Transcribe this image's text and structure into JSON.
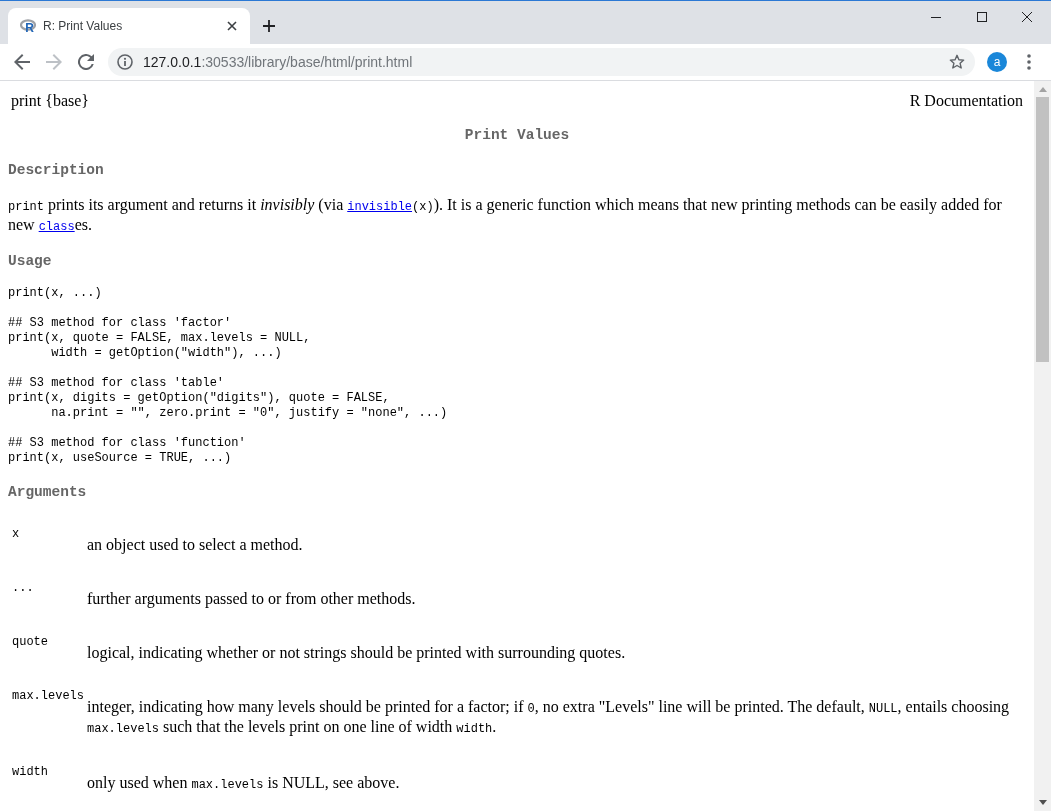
{
  "tabs": [
    {
      "title": "R: Print Values",
      "favicon": "R",
      "selected": true
    }
  ],
  "toolbar": {
    "forward_disabled": true,
    "url": {
      "host": "127.0.0.1",
      "path": ":30533/library/base/html/print.html"
    },
    "profile": "a"
  },
  "page": {
    "header": {
      "left": "print {base}",
      "right": "R Documentation"
    },
    "title": "Print Values",
    "sections": [
      {
        "kind": "paragraph",
        "heading": "Description",
        "segments": [
          {
            "kind": "code",
            "text": "print"
          },
          {
            "kind": "text",
            "text": " prints its argument and returns it *invisibly* (via "
          },
          {
            "kind": "link",
            "text": "invisible"
          },
          {
            "kind": "code",
            "text": "(x)"
          },
          {
            "kind": "text",
            "text": "). It is a generic function which means that new printing methods can be easily added for new "
          },
          {
            "kind": "link",
            "text": "class"
          },
          {
            "kind": "text",
            "text": "es."
          }
        ]
      },
      {
        "kind": "code",
        "heading": "Usage",
        "blocks": [
          "print(x, ...)",
          "## S3 method for class 'factor'\nprint(x, quote = FALSE, max.levels = NULL,\n      width = getOption(\"width\"), ...)",
          "## S3 method for class 'table'\nprint(x, digits = getOption(\"digits\"), quote = FALSE,\n      na.print = \"\", zero.print = \"0\", justify = \"none\", ...)",
          "## S3 method for class 'function'\nprint(x, useSource = TRUE, ...)"
        ]
      },
      {
        "kind": "arguments",
        "heading": "Arguments",
        "items": [
          {
            "name": "x",
            "description": [
              {
                "kind": "text",
                "text": "an object used to select a method."
              }
            ]
          },
          {
            "name": "...",
            "description": [
              {
                "kind": "text",
                "text": "further arguments passed to or from other methods."
              }
            ]
          },
          {
            "name": "quote",
            "description": [
              {
                "kind": "text",
                "text": "logical, indicating whether or not strings should be printed with surrounding quotes."
              }
            ]
          },
          {
            "name": "max.levels",
            "description": [
              {
                "kind": "text",
                "text": "integer, indicating how many levels should be printed for a factor; if "
              },
              {
                "kind": "code",
                "text": "0"
              },
              {
                "kind": "text",
                "text": ", no extra \"Levels\" line will be printed. The default, "
              },
              {
                "kind": "code",
                "text": "NULL"
              },
              {
                "kind": "text",
                "text": ", entails choosing "
              },
              {
                "kind": "code",
                "text": "max.levels"
              },
              {
                "kind": "text",
                "text": " such that the levels print on one line of width "
              },
              {
                "kind": "code",
                "text": "width"
              },
              {
                "kind": "text",
                "text": "."
              }
            ]
          },
          {
            "name": "width",
            "description": [
              {
                "kind": "text",
                "text": "only used when "
              },
              {
                "kind": "code",
                "text": "max.levels"
              },
              {
                "kind": "text",
                "text": " is NULL, see above."
              }
            ]
          }
        ]
      }
    ]
  }
}
